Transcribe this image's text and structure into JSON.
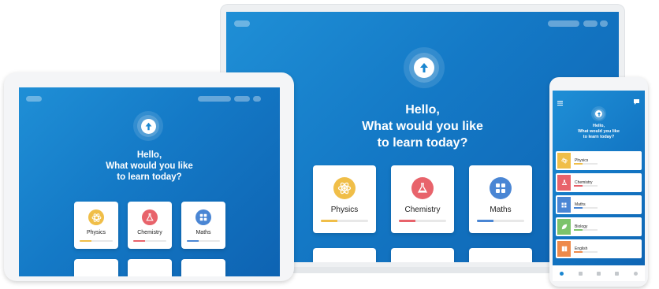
{
  "greeting": {
    "line1": "Hello,",
    "line2": "What would you like",
    "line3": "to learn today?"
  },
  "subjects": [
    {
      "label": "Physics",
      "icon": "atom-icon",
      "color": "#f0be48",
      "progress": 0.35
    },
    {
      "label": "Chemistry",
      "icon": "flask-icon",
      "color": "#e8636b",
      "progress": 0.35
    },
    {
      "label": "Maths",
      "icon": "calculator-icon",
      "color": "#4a86d4",
      "progress": 0.35
    }
  ],
  "phone_subjects": [
    {
      "label": "Physics",
      "icon": "atom-icon",
      "color": "#f0be48"
    },
    {
      "label": "Chemistry",
      "icon": "flask-icon",
      "color": "#e8636b"
    },
    {
      "label": "Maths",
      "icon": "calculator-icon",
      "color": "#4a86d4"
    },
    {
      "label": "Biology",
      "icon": "leaf-icon",
      "color": "#7cc36b"
    },
    {
      "label": "English",
      "icon": "book-icon",
      "color": "#ee8a4a"
    }
  ],
  "colors": {
    "screen_gradient_start": "#1f8fd6",
    "screen_gradient_end": "#0e63b2",
    "device_frame": "#f2f4f6"
  }
}
